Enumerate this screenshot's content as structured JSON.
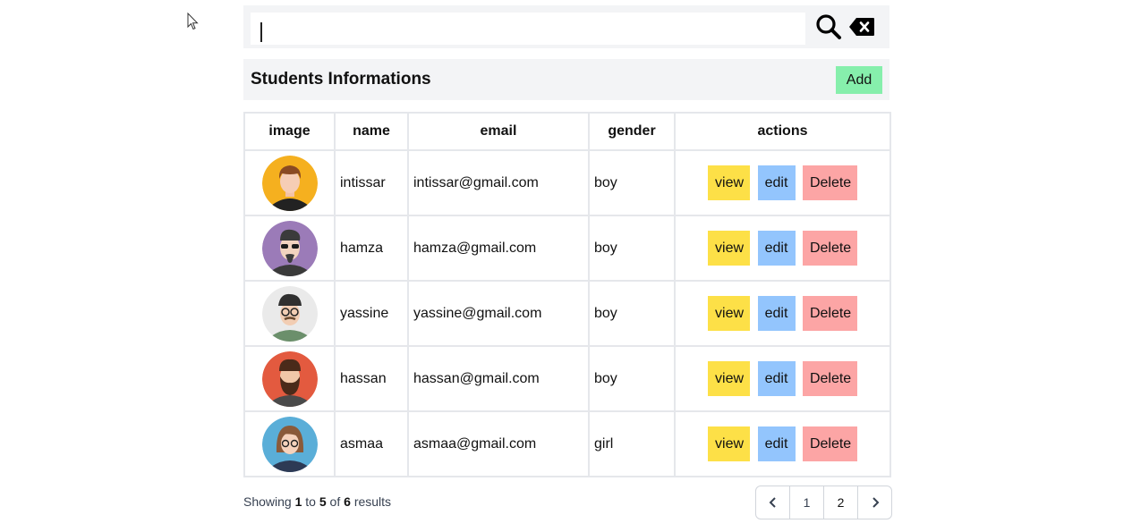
{
  "search": {
    "value": "",
    "placeholder": "",
    "search_icon": "search-icon",
    "clear_icon": "backspace-clear-icon"
  },
  "header": {
    "title": "Students Informations",
    "add_label": "Add"
  },
  "table": {
    "columns": [
      "image",
      "name",
      "email",
      "gender",
      "actions"
    ],
    "rows": [
      {
        "name": "intissar",
        "email": "intissar@gmail.com",
        "gender": "boy",
        "avatar_color": "#f5b01f"
      },
      {
        "name": "hamza",
        "email": "hamza@gmail.com",
        "gender": "boy",
        "avatar_color": "#9b7bb8"
      },
      {
        "name": "yassine",
        "email": "yassine@gmail.com",
        "gender": "boy",
        "avatar_color": "#eaeaea"
      },
      {
        "name": "hassan",
        "email": "hassan@gmail.com",
        "gender": "boy",
        "avatar_color": "#e35a3f"
      },
      {
        "name": "asmaa",
        "email": "asmaa@gmail.com",
        "gender": "girl",
        "avatar_color": "#5aaed8"
      }
    ],
    "actions": {
      "view": "view",
      "edit": "edit",
      "delete": "Delete"
    }
  },
  "summary": {
    "prefix": "Showing",
    "from": "1",
    "to_word": "to",
    "to": "5",
    "of_word": "of",
    "total": "6",
    "suffix": "results"
  },
  "pagination": {
    "prev_icon": "chevron-left-icon",
    "pages": [
      "1",
      "2"
    ],
    "next_icon": "chevron-right-icon"
  },
  "colors": {
    "add": "#86efac",
    "view": "#fde047",
    "edit": "#93c5fd",
    "delete": "#fca5a5",
    "panel": "#f3f4f6"
  }
}
